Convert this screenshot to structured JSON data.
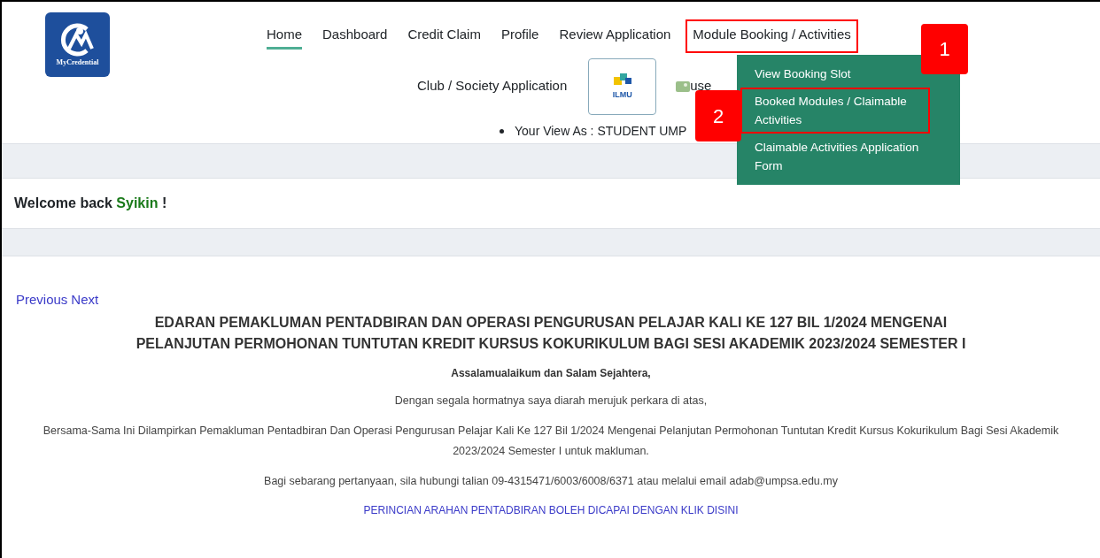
{
  "logo": {
    "text": "MyCredential"
  },
  "nav": {
    "items": [
      {
        "label": "Home",
        "selected": true,
        "highlighted": false
      },
      {
        "label": "Dashboard",
        "selected": false,
        "highlighted": false
      },
      {
        "label": "Credit Claim",
        "selected": false,
        "highlighted": false
      },
      {
        "label": "Profile",
        "selected": false,
        "highlighted": false
      },
      {
        "label": "Review Application",
        "selected": false,
        "highlighted": false
      },
      {
        "label": "Module Booking / Activities",
        "selected": false,
        "highlighted": true,
        "expanded": true
      }
    ],
    "second_row": {
      "link": "Club / Society Application",
      "ilmu_logo": "ILMU",
      "user_image_alt": "use"
    },
    "view_as": "Your View As : STUDENT UMP"
  },
  "dropdown": {
    "items": [
      {
        "label": "View Booking Slot",
        "highlighted": false
      },
      {
        "label": "Booked Modules / Claimable Activities",
        "highlighted": true
      },
      {
        "label": "Claimable Activities Application Form",
        "highlighted": false
      }
    ]
  },
  "callouts": [
    {
      "label": "1"
    },
    {
      "label": "2"
    }
  ],
  "welcome": {
    "prefix": "Welcome back",
    "name": "Syikin",
    "suffix": "!"
  },
  "carousel": {
    "previous": "Previous",
    "next": "Next"
  },
  "announcement": {
    "title": "EDARAN PEMAKLUMAN PENTADBIRAN DAN OPERASI PENGURUSAN PELAJAR KALI KE 127 BIL 1/2024 MENGENAI PELANJUTAN PERMOHONAN TUNTUTAN KREDIT KURSUS KOKURIKULUM BAGI SESI AKADEMIK 2023/2024 SEMESTER I",
    "greeting": "Assalamualaikum dan Salam Sejahtera,",
    "paragraphs": [
      "Dengan segala hormatnya saya diarah merujuk perkara di atas,",
      "Bersama-Sama Ini Dilampirkan Pemakluman Pentadbiran Dan Operasi Pengurusan Pelajar Kali Ke 127 Bil 1/2024 Mengenai Pelanjutan Permohonan Tuntutan Kredit Kursus Kokurikulum Bagi Sesi Akademik 2023/2024 Semester I untuk makluman.",
      "Bagi sebarang pertanyaan, sila hubungi talian 09-4315471/6003/6008/6371 atau melalui email adab@umpsa.edu.my"
    ],
    "link": "PERINCIAN ARAHAN PENTADBIRAN BOLEH DICAPAI DENGAN KLIK DISINI"
  }
}
